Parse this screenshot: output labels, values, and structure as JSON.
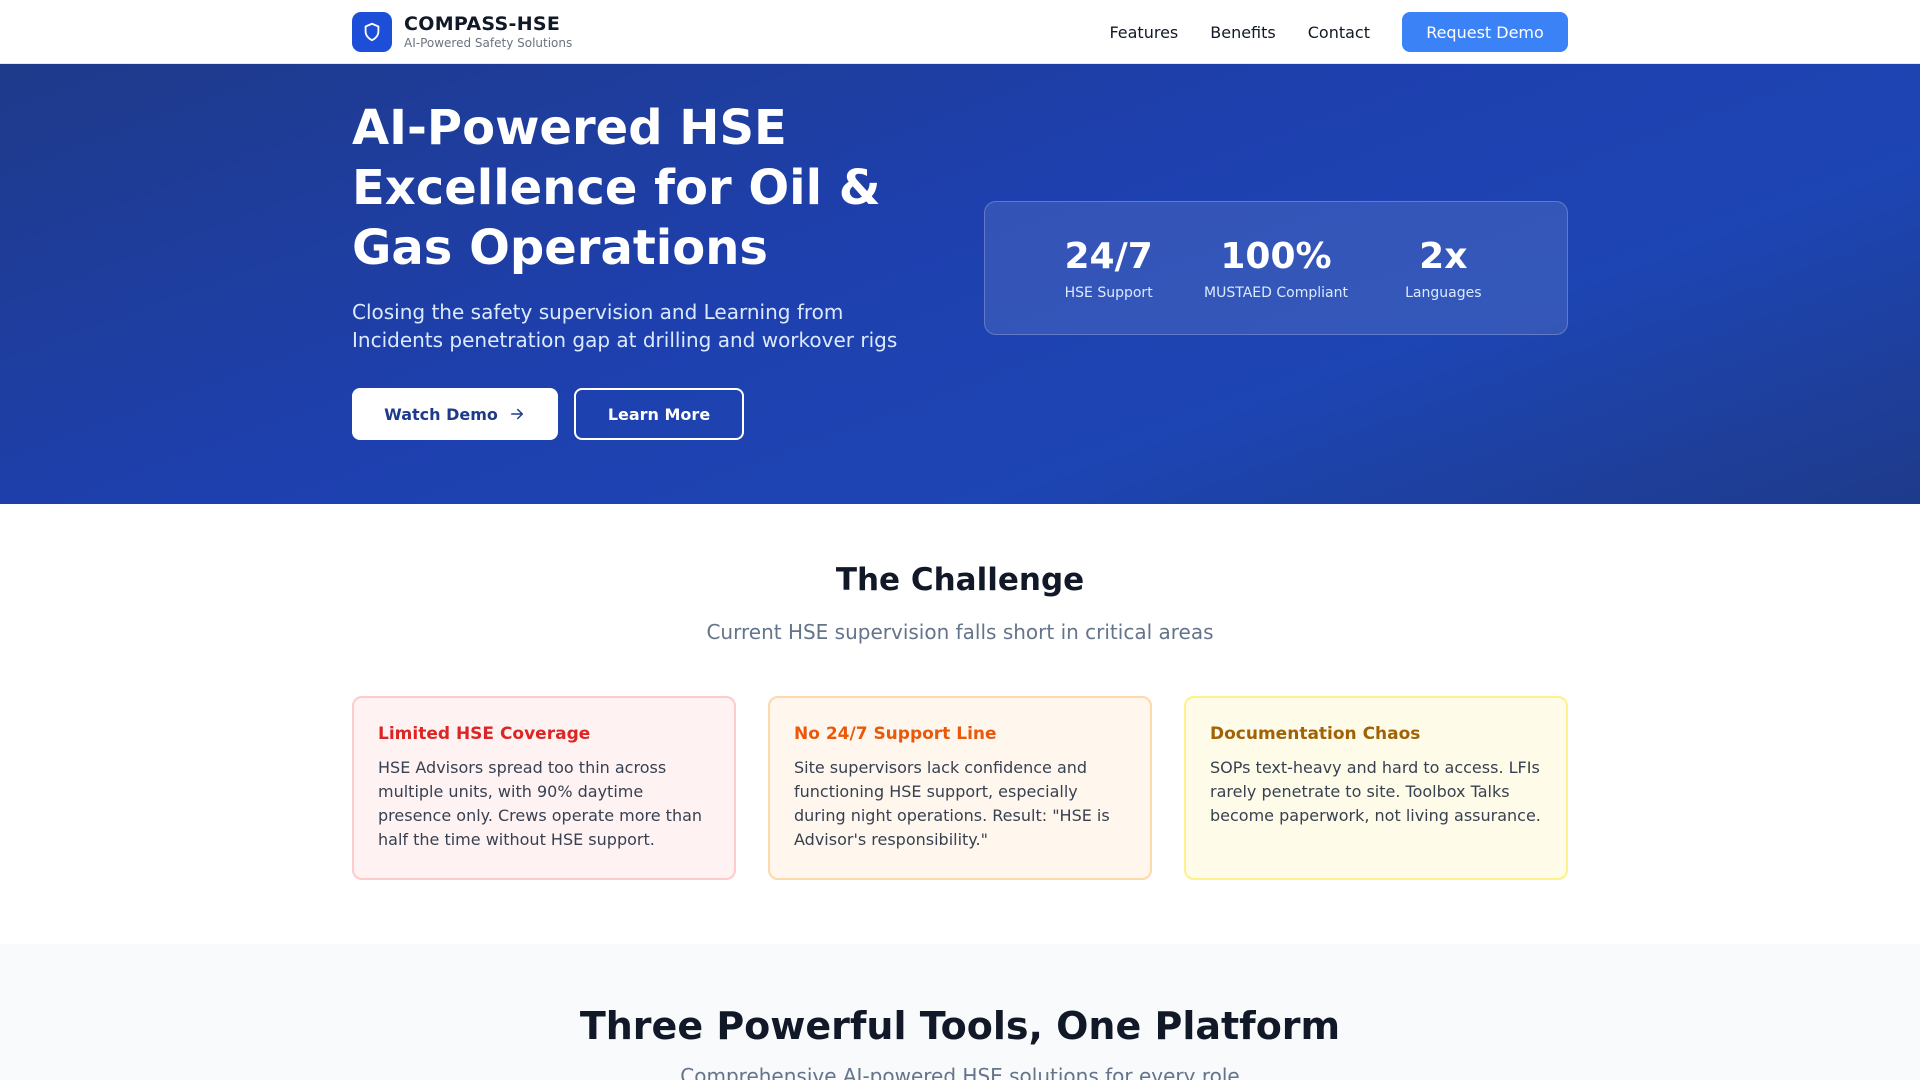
{
  "nav": {
    "brand_name": "COMPASS-HSE",
    "brand_tagline": "AI-Powered Safety Solutions",
    "links": [
      {
        "label": "Features"
      },
      {
        "label": "Benefits"
      },
      {
        "label": "Contact"
      }
    ],
    "cta_label": "Request Demo",
    "logo_icon": "shield-icon"
  },
  "hero": {
    "title": "AI-Powered HSE Excellence for Oil & Gas Operations",
    "subtitle": "Closing the safety supervision and Learning from Incidents penetration gap at drilling and workover rigs",
    "primary_button": "Watch Demo",
    "secondary_button": "Learn More",
    "stats": [
      {
        "value": "24/7",
        "label": "HSE Support"
      },
      {
        "value": "100%",
        "label": "MUSTAED Compliant"
      },
      {
        "value": "2x",
        "label": "Languages"
      }
    ]
  },
  "challenge": {
    "title": "The Challenge",
    "subtitle": "Current HSE supervision falls short in critical areas",
    "cards": [
      {
        "title": "Limited HSE Coverage",
        "body": "HSE Advisors spread too thin across multiple units, with 90% daytime presence only. Crews operate more than half the time without HSE support."
      },
      {
        "title": "No 24/7 Support Line",
        "body": "Site supervisors lack confidence and functioning HSE support, especially during night operations. Result: \"HSE is Advisor's responsibility.\""
      },
      {
        "title": "Documentation Chaos",
        "body": "SOPs text-heavy and hard to access. LFIs rarely penetrate to site. Toolbox Talks become paperwork, not living assurance."
      }
    ]
  },
  "tools": {
    "title": "Three Powerful Tools, One Platform",
    "subtitle": "Comprehensive AI-powered HSE solutions for every role"
  },
  "colors": {
    "primary": "#1d4ed8",
    "cta": "#3b82f6",
    "hero_dark": "#1e3a8a",
    "red": "#dc2626",
    "orange": "#ea580c",
    "yellow": "#a16207"
  }
}
